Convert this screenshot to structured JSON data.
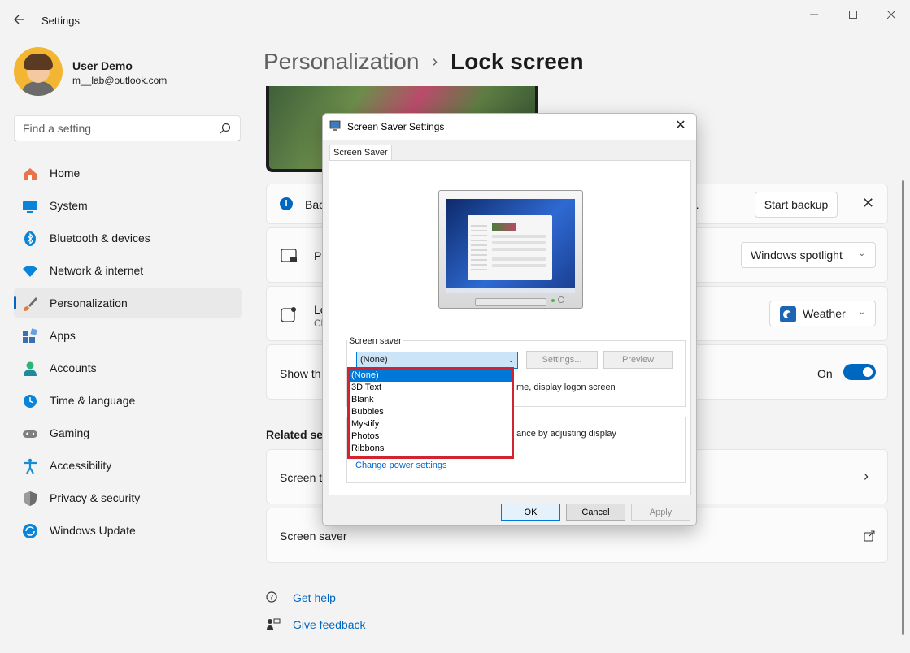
{
  "window": {
    "title": "Settings",
    "back_icon": "arrow-left",
    "controls": [
      "minimize",
      "maximize",
      "close"
    ]
  },
  "profile": {
    "name": "User Demo",
    "email": "m__lab@outlook.com"
  },
  "search": {
    "placeholder": "Find a setting"
  },
  "sidebar": {
    "items": [
      {
        "label": "Home",
        "icon": "home-icon",
        "color": "#e8744c"
      },
      {
        "label": "System",
        "icon": "system-icon",
        "color": "#0a84d8"
      },
      {
        "label": "Bluetooth & devices",
        "icon": "bluetooth-icon",
        "color": "#0a84d8"
      },
      {
        "label": "Network & internet",
        "icon": "wifi-icon",
        "color": "#0a84d8"
      },
      {
        "label": "Personalization",
        "icon": "brush-icon",
        "color": "#e07a3f",
        "active": true
      },
      {
        "label": "Apps",
        "icon": "apps-icon",
        "color": "#3a6fb0"
      },
      {
        "label": "Accounts",
        "icon": "accounts-icon",
        "color": "#2bb673"
      },
      {
        "label": "Time & language",
        "icon": "clock-icon",
        "color": "#0a84d8"
      },
      {
        "label": "Gaming",
        "icon": "gamepad-icon",
        "color": "#7f7f7f"
      },
      {
        "label": "Accessibility",
        "icon": "accessibility-icon",
        "color": "#1a8bd1"
      },
      {
        "label": "Privacy & security",
        "icon": "shield-icon",
        "color": "#6d6d6d"
      },
      {
        "label": "Windows Update",
        "icon": "update-icon",
        "color": "#0a84d8"
      }
    ]
  },
  "main": {
    "breadcrumb": {
      "parent": "Personalization",
      "separator": "›",
      "current": "Lock screen"
    },
    "backup_card": {
      "text_start": "Bac",
      "text_end": "e.",
      "button": "Start backup"
    },
    "personalize_card": {
      "text": "Pe",
      "dropdown_value": "Windows spotlight"
    },
    "status_card": {
      "text": "Lo",
      "sub": "Cl",
      "dropdown_value": "Weather"
    },
    "signin_card": {
      "text": "Show th",
      "toggle_label": "On"
    },
    "related_title": "Related set",
    "screen_timeout_card": {
      "text": "Screen ti"
    },
    "screen_saver_card": {
      "text": "Screen saver"
    },
    "help": {
      "get_help": "Get help",
      "give_feedback": "Give feedback"
    }
  },
  "dialog": {
    "title": "Screen Saver Settings",
    "tab": "Screen Saver",
    "group_label": "Screen saver",
    "selected": "(None)",
    "settings_button": "Settings...",
    "preview_button": "Preview",
    "resume_text": "me, display logon screen",
    "power_text": "ance by adjusting display",
    "power_link": "Change power settings",
    "ok": "OK",
    "cancel": "Cancel",
    "apply": "Apply",
    "options": [
      "(None)",
      "3D Text",
      "Blank",
      "Bubbles",
      "Mystify",
      "Photos",
      "Ribbons"
    ]
  }
}
